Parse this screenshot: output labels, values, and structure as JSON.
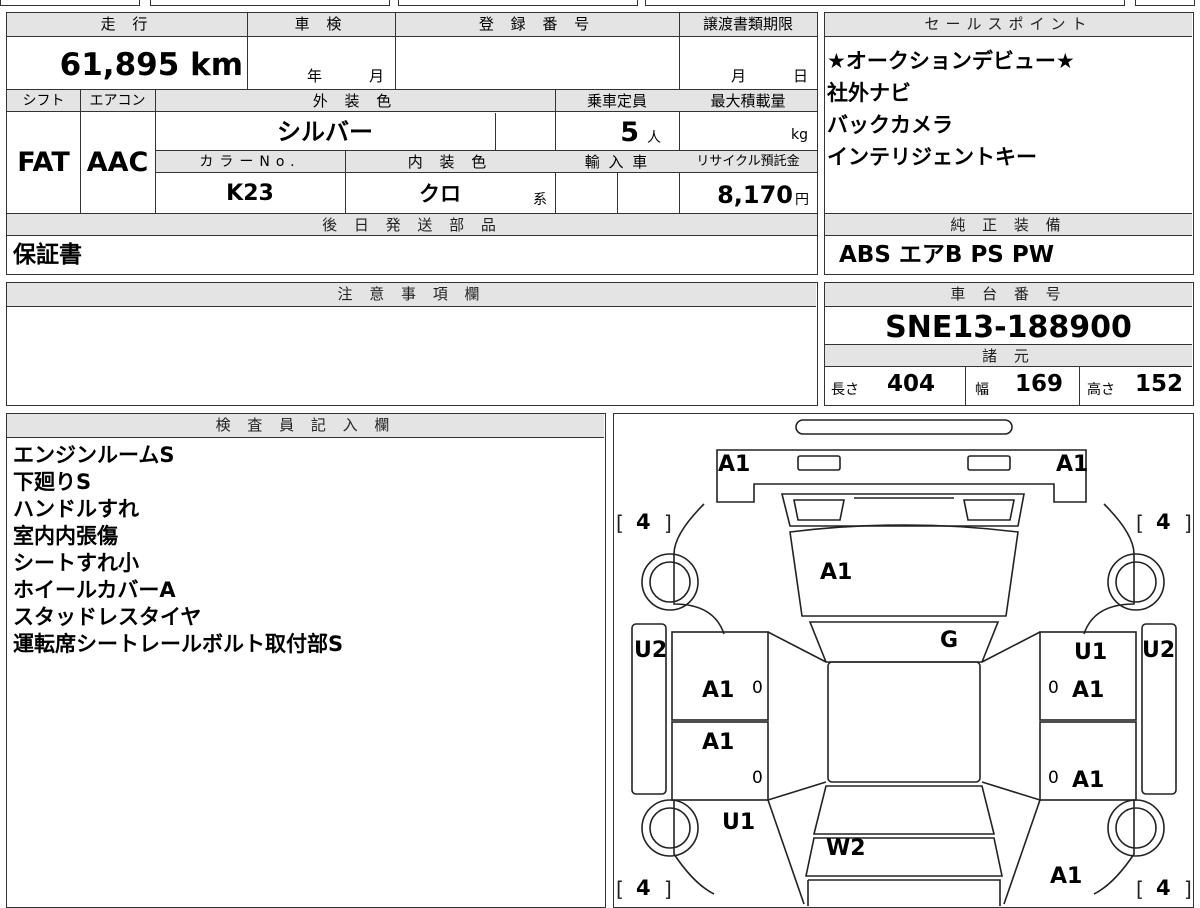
{
  "header": {
    "mileage_label": "走 行",
    "shaken_label": "車 検",
    "registration_label": "登 録 番 号",
    "transfer_deadline_label": "譲渡書類期限",
    "sales_point_label": "セールスポイント"
  },
  "vehicle": {
    "mileage": "61,895 km",
    "shaken_year": "年",
    "shaken_month": "月",
    "registration_number": "",
    "transfer_month": "月",
    "transfer_day": "日",
    "shift_label": "シフト",
    "shift": "FAT",
    "ac_label": "エアコン",
    "ac": "AAC",
    "exterior_color_label": "外 装 色",
    "exterior_color": "シルバー",
    "capacity_label": "乗車定員",
    "capacity": "5",
    "capacity_unit": "人",
    "max_load_label": "最大積載量",
    "max_load_unit": "kg",
    "color_no_label": "カラーNo.",
    "color_no": "K23",
    "interior_color_label": "内 装 色",
    "interior_color": "クロ",
    "interior_color_suffix": "系",
    "import_label": "輸 入 車",
    "recycle_label": "リサイクル預託金",
    "recycle_fee": "8,170",
    "recycle_unit": "円"
  },
  "sales_points": {
    "items": [
      "★オークションデビュー★",
      "社外ナビ",
      "バックカメラ",
      "インテリジェントキー"
    ]
  },
  "later_parts": {
    "label": "後 日 発 送 部 品",
    "value": "保証書"
  },
  "genuine_equipment": {
    "label": "純 正 装 備",
    "value": "ABS エアB PS PW"
  },
  "notes": {
    "label": "注 意 事 項 欄",
    "value": ""
  },
  "chassis": {
    "label": "車 台 番 号",
    "number": "SNE13-188900",
    "specs_label": "諸 元",
    "length_label": "長さ",
    "length": "404",
    "width_label": "幅",
    "width": "169",
    "height_label": "高さ",
    "height": "152"
  },
  "inspector": {
    "label": "検 査 員 記 入 欄",
    "lines": [
      "エンジンルームS",
      "下廻りS",
      "ハンドルすれ",
      "室内内張傷",
      "シートすれ小",
      "ホイールカバーA",
      "スタッドレスタイヤ",
      "運転席シートレールボルト取付部S"
    ]
  },
  "diagram": {
    "marks": {
      "front_left": "A1",
      "front_right": "A1",
      "tire_fl": "4",
      "tire_fr": "4",
      "tire_rl": "4",
      "tire_rr": "4",
      "hood": "A1",
      "windshield": "G",
      "side_left": "U2",
      "side_right": "U2",
      "front_door_left": "A1",
      "rear_door_left": "A1",
      "front_door_right_a": "U1",
      "front_door_right_b": "A1",
      "rear_door_right": "A1",
      "rear_left": "U1",
      "rear_window": "W2",
      "rear_right": "A1",
      "zero_1": "0",
      "zero_2": "0",
      "zero_3": "0",
      "zero_4": "0"
    }
  }
}
